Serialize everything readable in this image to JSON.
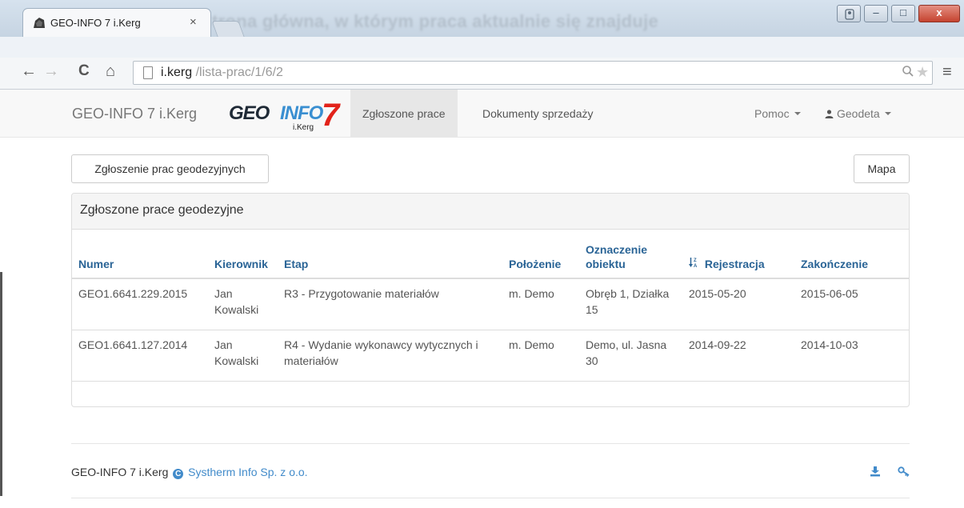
{
  "browser": {
    "tab_title": "GEO-INFO 7 i.Kerg",
    "tab_close": "×",
    "background_title": "Strona główna, w którym praca aktualnie się znajduje",
    "url_host": "i.kerg",
    "url_path": " /lista-prac/1/6/2",
    "nav_back": "←",
    "nav_forward": "→",
    "nav_reload": "C",
    "nav_home": "⌂",
    "zoom": "🔍",
    "star": "★",
    "menu": "≡",
    "win_user": "👤",
    "win_min": "–",
    "win_max": "□",
    "win_close": "x"
  },
  "navbar": {
    "brand": "GEO-INFO 7 i.Kerg",
    "logo_geo": "GEO",
    "logo_info": "INFO",
    "logo_seven": "7",
    "logo_kerg": "i.Kerg",
    "items": [
      {
        "label": "Zgłoszone prace",
        "active": true
      },
      {
        "label": "Dokumenty sprzedaży",
        "active": false
      }
    ],
    "help": "Pomoc",
    "user": "Geodeta"
  },
  "actions": {
    "new_report": "Zgłoszenie prac geodezyjnych",
    "map": "Mapa"
  },
  "panel": {
    "title": "Zgłoszone prace geodezyjne",
    "columns": [
      "Numer",
      "Kierownik",
      "Etap",
      "Położenie",
      "Oznaczenie obiektu",
      "Rejestracja",
      "Zakończenie"
    ],
    "rows": [
      {
        "numer": "GEO1.6641.229.2015",
        "kierownik": "Jan Kowalski",
        "etap": "R3 - Przygotowanie materiałów",
        "polozenie": "m. Demo",
        "oznaczenie": "Obręb 1, Działka 15",
        "rejestracja": "2015-05-20",
        "zakonczenie": "2015-06-05"
      },
      {
        "numer": "GEO1.6641.127.2014",
        "kierownik": "Jan Kowalski",
        "etap": "R4 - Wydanie wykonawcy wytycznych i materiałów",
        "polozenie": "m. Demo",
        "oznaczenie": "Demo, ul. Jasna 30",
        "rejestracja": "2014-09-22",
        "zakonczenie": "2014-10-03"
      }
    ]
  },
  "footer": {
    "product": "GEO-INFO 7 i.Kerg",
    "copyright_symbol": "C",
    "company": "Systherm Info Sp. z o.o."
  },
  "colors": {
    "link": "#428bca",
    "header_link": "#2a6496",
    "logo_red": "#e2231a",
    "logo_blue": "#3a8fd1"
  }
}
